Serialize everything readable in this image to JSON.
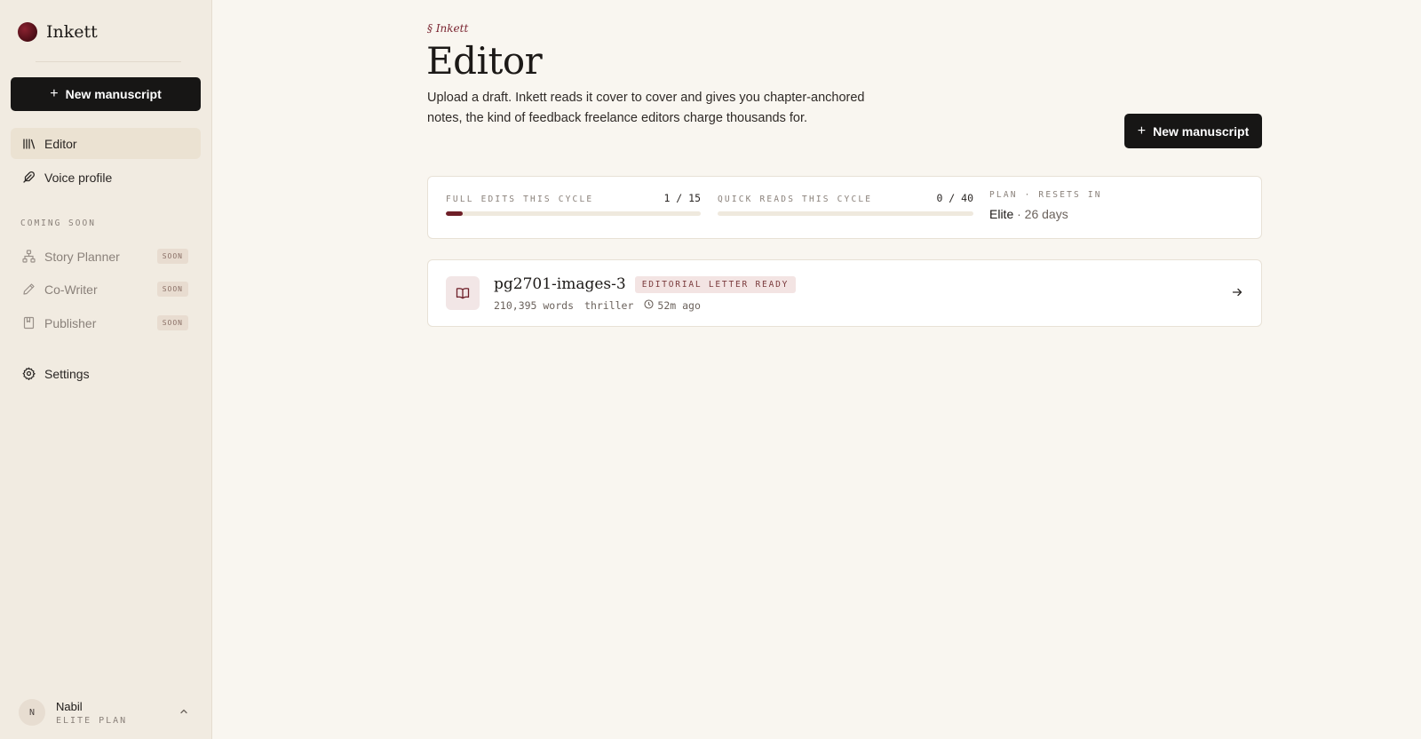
{
  "brand": {
    "name": "Inkett"
  },
  "sidebar": {
    "new_button_label": "New manuscript",
    "nav": [
      {
        "label": "Editor",
        "icon": "library-icon",
        "active": true
      },
      {
        "label": "Voice profile",
        "icon": "feather-icon",
        "active": false
      }
    ],
    "coming_soon_label": "COMING SOON",
    "soon_items": [
      {
        "label": "Story Planner",
        "icon": "sitemap-icon",
        "badge": "SOON"
      },
      {
        "label": "Co-Writer",
        "icon": "pencil-icon",
        "badge": "SOON"
      },
      {
        "label": "Publisher",
        "icon": "book-bookmark-icon",
        "badge": "SOON"
      }
    ],
    "settings_label": "Settings",
    "user": {
      "initial": "N",
      "name": "Nabil",
      "plan": "ELITE PLAN"
    }
  },
  "header": {
    "eyebrow": "§ Inkett",
    "title": "Editor",
    "description": "Upload a draft. Inkett reads it cover to cover and gives you chapter-anchored notes, the kind of feedback freelance editors charge thousands for.",
    "new_button_label": "New manuscript"
  },
  "stats": {
    "full_edits": {
      "label": "FULL EDITS THIS CYCLE",
      "count": "1 / 15",
      "fraction": 0.0667
    },
    "quick_reads": {
      "label": "QUICK READS THIS CYCLE",
      "count": "0 / 40",
      "fraction": 0
    },
    "plan": {
      "label": "PLAN · RESETS IN",
      "name": "Elite",
      "resets": "· 26 days"
    }
  },
  "manuscripts": [
    {
      "title": "pg2701-images-3",
      "status": "EDITORIAL LETTER READY",
      "words": "210,395 words",
      "genre": "thriller",
      "time": "52m ago"
    }
  ],
  "colors": {
    "accent": "#6e1f28",
    "background": "#f9f6f0",
    "sidebar": "#f1ebe1",
    "primary_button": "#171615"
  }
}
